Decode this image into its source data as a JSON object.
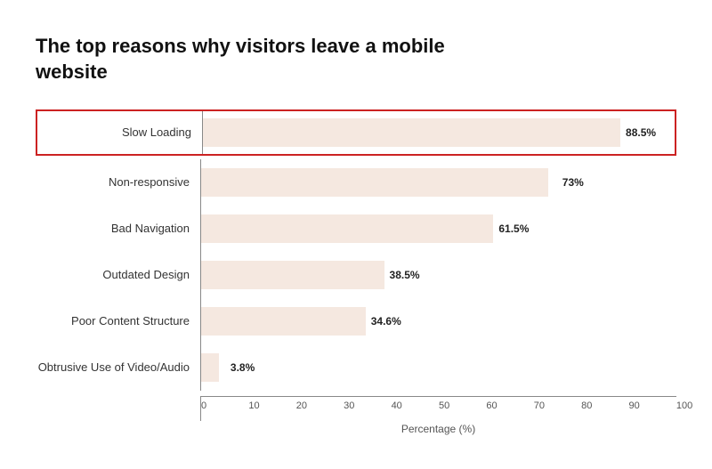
{
  "chart": {
    "title": "The top reasons why visitors leave a mobile website",
    "x_axis_title": "Percentage (%)",
    "x_ticks": [
      "0",
      "10",
      "20",
      "30",
      "40",
      "50",
      "60",
      "70",
      "80",
      "90",
      "100"
    ],
    "bars": [
      {
        "label": "Slow Loading",
        "value": 88.5,
        "value_label": "88.5%",
        "highlighted": true
      },
      {
        "label": "Non-responsive",
        "value": 73,
        "value_label": "73%",
        "highlighted": false
      },
      {
        "label": "Bad Navigation",
        "value": 61.5,
        "value_label": "61.5%",
        "highlighted": false
      },
      {
        "label": "Outdated Design",
        "value": 38.5,
        "value_label": "38.5%",
        "highlighted": false
      },
      {
        "label": "Poor Content Structure",
        "value": 34.6,
        "value_label": "34.6%",
        "highlighted": false
      },
      {
        "label": "Obtrusive Use of Video/Audio",
        "value": 3.8,
        "value_label": "3.8%",
        "highlighted": false
      }
    ]
  }
}
